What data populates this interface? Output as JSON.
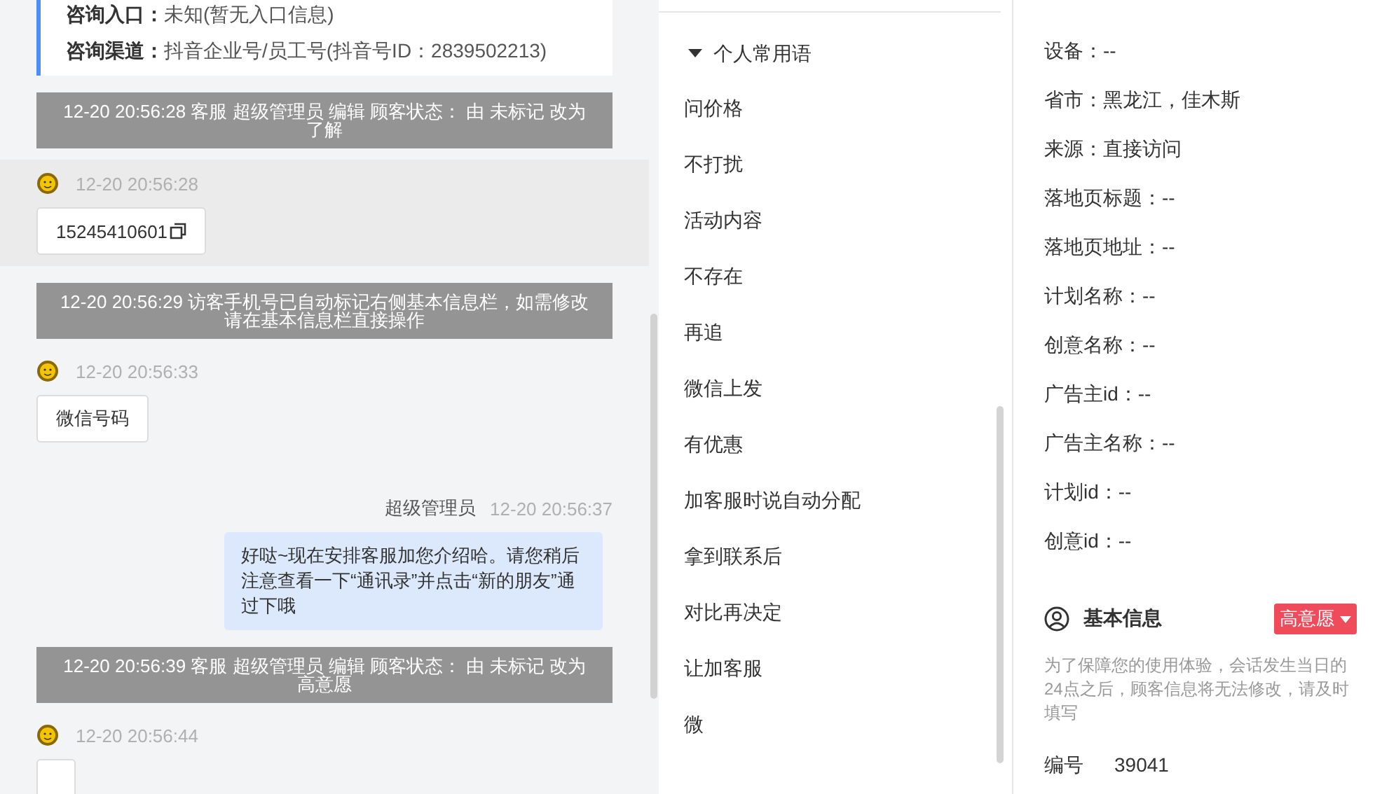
{
  "chat": {
    "info_card": [
      {
        "label": "咨询入口：",
        "value": "未知(暂无入口信息)"
      },
      {
        "label": "咨询渠道：",
        "value": "抖音企业号/员工号(抖音号ID：2839502213)"
      }
    ],
    "messages": [
      {
        "kind": "system",
        "text": "12-20 20:56:28 客服 超级管理员 编辑 顾客状态： 由 未标记 改为了解"
      },
      {
        "kind": "visitor",
        "selected": true,
        "time": "12-20 20:56:28",
        "text": "15245410601",
        "copyable": true
      },
      {
        "kind": "system",
        "text": "12-20 20:56:29 访客手机号已自动标记右侧基本信息栏，如需修改请在基本信息栏直接操作"
      },
      {
        "kind": "visitor",
        "selected": false,
        "time": "12-20 20:56:33",
        "text": "微信号码",
        "copyable": false
      },
      {
        "kind": "agent",
        "sender": "超级管理员",
        "time": "12-20 20:56:37",
        "text": "好哒~现在安排客服加您介绍哈。请您稍后注意查看一下“通讯录”并点击“新的朋友”通过下哦"
      },
      {
        "kind": "system",
        "text": "12-20 20:56:39 客服 超级管理员 编辑 顾客状态： 由 未标记 改为高意愿"
      },
      {
        "kind": "visitor",
        "selected": false,
        "time": "12-20 20:56:44",
        "copyable": false
      }
    ]
  },
  "phrases": {
    "group": {
      "label": "个人常用语",
      "expanded": true
    },
    "items": [
      "问价格",
      "不打扰",
      "活动内容",
      "不存在",
      "再追",
      "微信上发",
      "有优惠",
      "加客服时说自动分配",
      "拿到联系后",
      "对比再决定",
      "让加客服",
      "微"
    ]
  },
  "source_info": {
    "lines": [
      "设备：--",
      "省市：黑龙江，佳木斯",
      "来源：直接访问",
      "落地页标题：--",
      "落地页地址：--",
      "计划名称：--",
      "创意名称：--",
      "广告主id：--",
      "广告主名称：--",
      "计划id：--",
      "创意id：--"
    ]
  },
  "basic_info": {
    "title": "基本信息",
    "intent_badge": "高意愿",
    "note": "为了保障您的使用体验，会话发生当日的24点之后，顾客信息将无法修改，请及时填写",
    "fields": [
      {
        "label": "编号",
        "value": "39041"
      }
    ]
  }
}
